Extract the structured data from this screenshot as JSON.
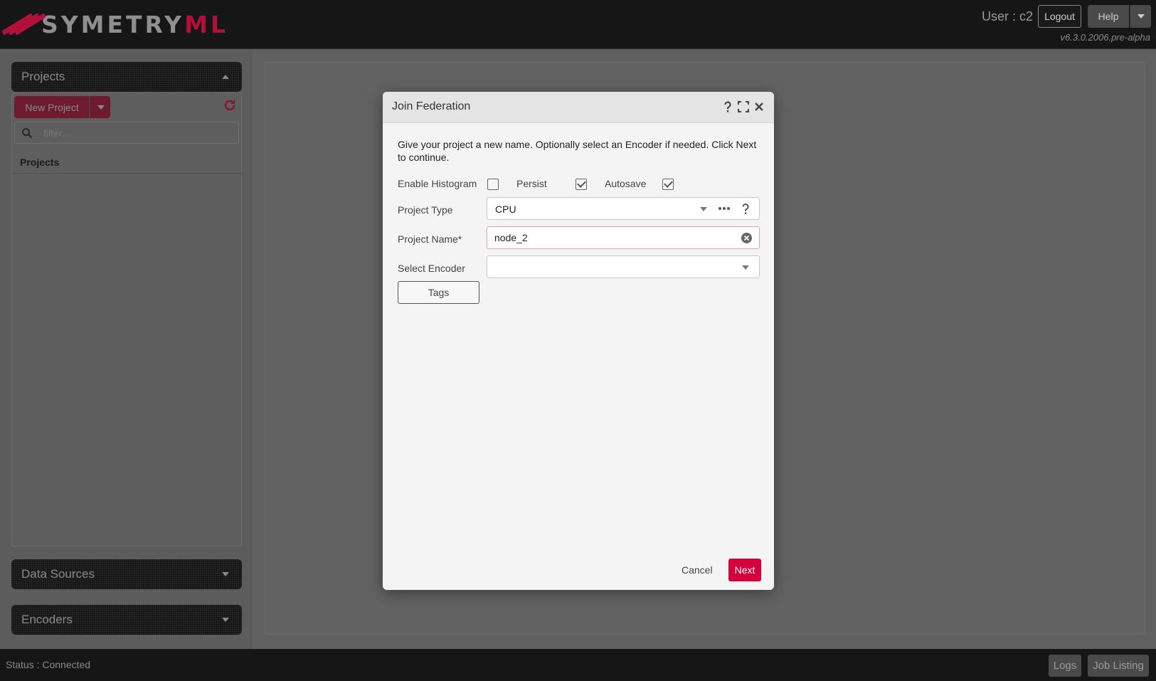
{
  "app": {
    "logo_text": "SYMETRY",
    "logo_text_accent": "ML",
    "version": "v6.3.0.2006.pre-alpha"
  },
  "header": {
    "user_label": "User : c2",
    "logout_label": "Logout",
    "help_label": "Help"
  },
  "sidebar": {
    "projects_title": "Projects",
    "new_project_label": "New Project",
    "filter_placeholder": "filter...",
    "projects_list_header": "Projects",
    "data_sources_title": "Data Sources",
    "encoders_title": "Encoders"
  },
  "footer": {
    "status": "Status : Connected",
    "logs_label": "Logs",
    "job_listing_label": "Job Listing"
  },
  "modal": {
    "title": "Join Federation",
    "intro": "Give your project a new name. Optionally select an Encoder if needed. Click Next to continue.",
    "enable_histogram_label": "Enable Histogram",
    "enable_histogram_checked": false,
    "persist_label": "Persist",
    "persist_checked": true,
    "autosave_label": "Autosave",
    "autosave_checked": true,
    "project_type_label": "Project Type",
    "project_type_value": "CPU",
    "project_name_label": "Project Name*",
    "project_name_value": "node_2",
    "select_encoder_label": "Select Encoder",
    "select_encoder_value": "",
    "tags_label": "Tags",
    "cancel_label": "Cancel",
    "next_label": "Next"
  },
  "colors": {
    "accent": "#d3003c",
    "header_bg": "#161616",
    "modal_bg": "#f4f4f4"
  }
}
